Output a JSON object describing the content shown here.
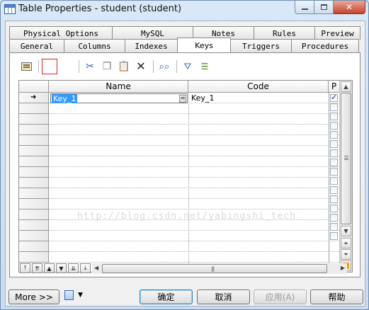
{
  "window": {
    "title": "Table Properties - student (student)",
    "min_label": "",
    "close_label": "✕"
  },
  "tabs": {
    "row1": [
      "Physical Options",
      "MySQL",
      "Notes",
      "Rules",
      "Preview"
    ],
    "row2": [
      "General",
      "Columns",
      "Indexes",
      "Keys",
      "Triggers",
      "Procedures"
    ],
    "active": "Keys"
  },
  "toolbar": {
    "icons": [
      "properties-icon",
      "add-row-icon",
      "insert-row-icon",
      "cut-icon",
      "copy-icon",
      "paste-icon",
      "delete-icon",
      "find-icon",
      "filter-icon",
      "customize-columns-icon"
    ],
    "selected": "add-row-icon"
  },
  "grid": {
    "columns": [
      "Name",
      "Code",
      "P"
    ],
    "rows": [
      {
        "name": "Key_1",
        "code": "Key_1",
        "primary": true,
        "current": true
      }
    ],
    "empty_rows": 15,
    "cell_button": "=",
    "watermark": "http://blog.csdn.net/yabingshi_tech"
  },
  "nav_buttons": [
    "⤒",
    "⇈",
    "▲",
    "▼",
    "⇊",
    "⤓"
  ],
  "buttons": {
    "more": "More >>",
    "ok": "确定",
    "cancel": "取消",
    "apply": "应用(A)",
    "help": "帮助"
  }
}
